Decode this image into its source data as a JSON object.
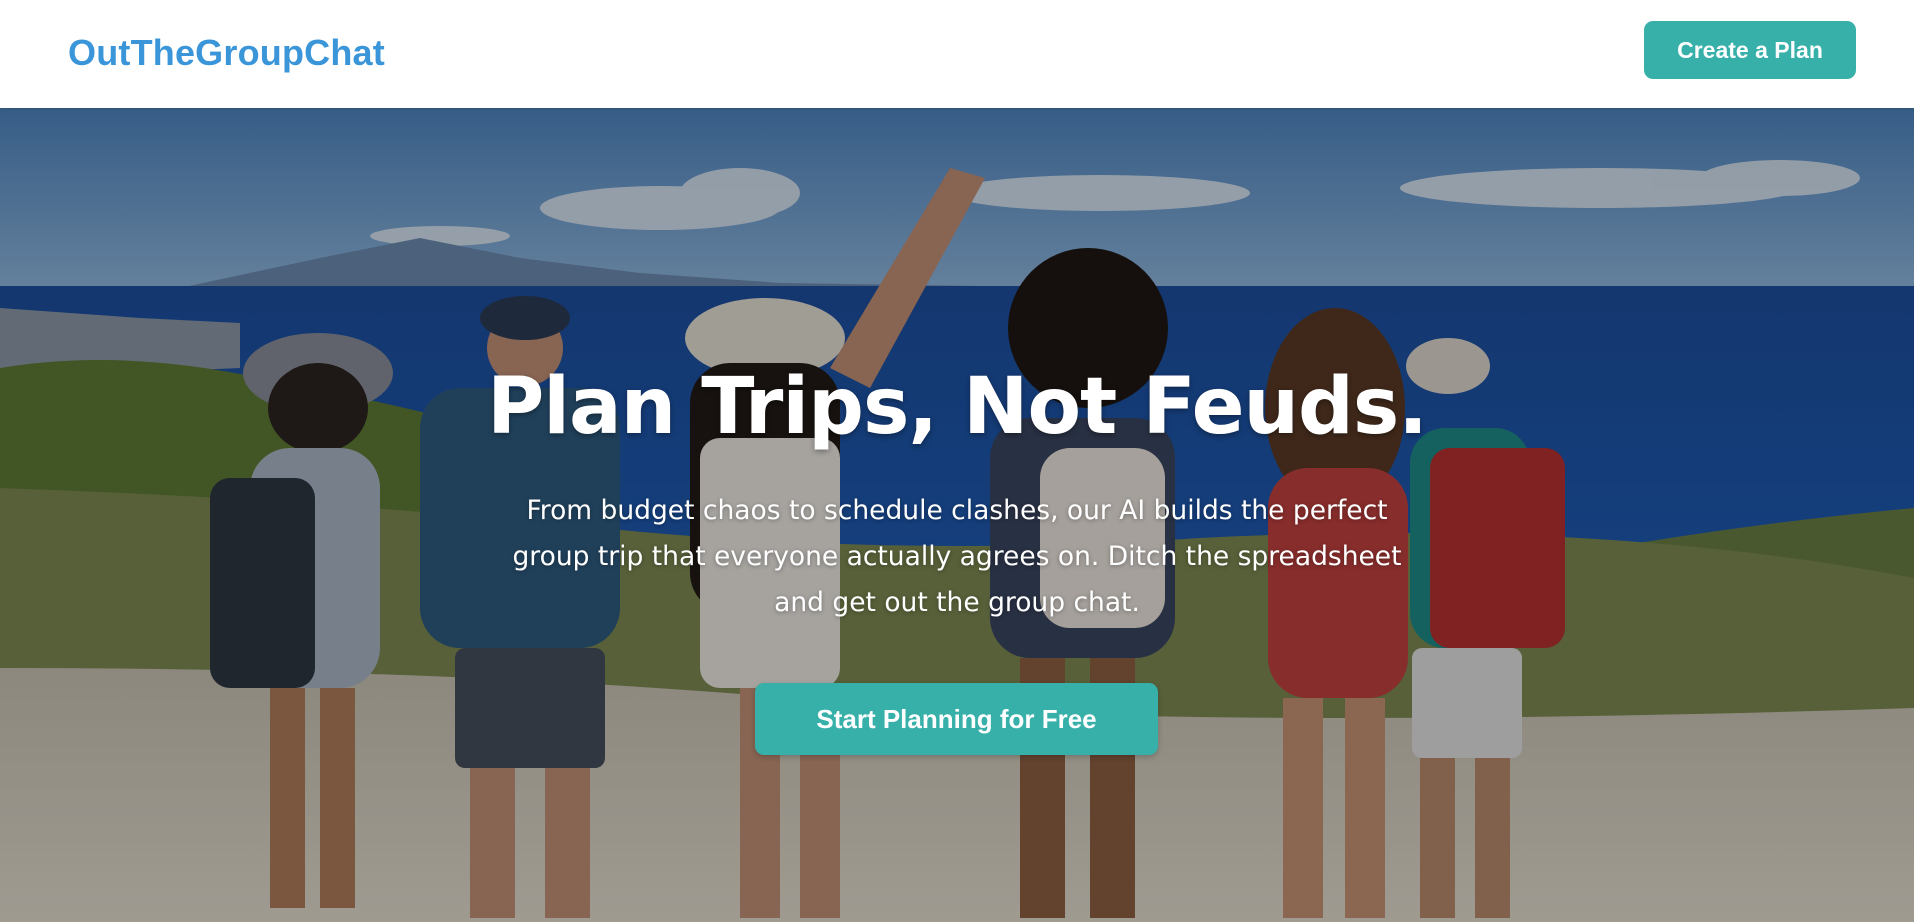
{
  "header": {
    "logo": "OutTheGroupChat",
    "cta_label": "Create a Plan"
  },
  "hero": {
    "title": "Plan Trips, Not Feuds.",
    "subtitle": "From budget chaos to schedule clashes, our AI builds the perfect group trip that everyone actually agrees on. Ditch the spreadsheet and get out the group chat.",
    "cta_label": "Start Planning for Free",
    "image": "friends-overlooking-sea-photo"
  },
  "colors": {
    "brand_blue": "#3a95d9",
    "accent_teal": "#36b0a9"
  }
}
